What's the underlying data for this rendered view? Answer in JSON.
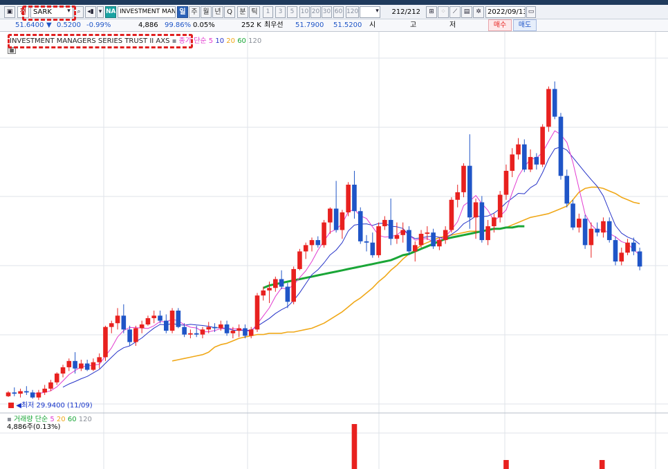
{
  "toolbar": {
    "market_label": "천",
    "symbol": "SARK",
    "na_badge": "NA",
    "name_field": "INVESTMENT MANA",
    "period_tabs": [
      "일",
      "주",
      "월",
      "년",
      "Q",
      "분",
      "틱"
    ],
    "active_tab": "일",
    "intervals": [
      "1",
      "3",
      "5",
      "10",
      "20",
      "30",
      "60",
      "120"
    ],
    "count": "212/212",
    "date": "2022/09/13"
  },
  "quote": {
    "price": "51.6400",
    "change": "0.5200",
    "change_pct": "-0.99%",
    "volume": "4,886",
    "ratio": "99.86%",
    "turnover": "0.05%",
    "amount": "252 K",
    "best_quote_label": "최우선",
    "best_ask": "51.7900",
    "best_bid": "51.5200",
    "open_label": "시",
    "high_label": "고",
    "low_label": "저",
    "buy_label": "매수",
    "sell_label": "매도"
  },
  "chart_legend": {
    "instrument": "INVESTMENT MANAGERS SERIES TRUST II AXS",
    "ma_prefix": "종가 단순",
    "ma_periods": [
      "5",
      "10",
      "20",
      "60",
      "120"
    ]
  },
  "low_marker": "최저 29.9400 (11/09)",
  "volume_legend": {
    "prefix": "거래량 단순",
    "periods": [
      "5",
      "20",
      "60",
      "120"
    ],
    "value": "4,886주(0.13%)"
  },
  "colors": {
    "up": "#e8211f",
    "down": "#1f55c7",
    "ma5": "#e23bd0",
    "ma10": "#2633c8",
    "ma20": "#f0a818",
    "ma60": "#1aa637",
    "grid": "#dfe3ea"
  },
  "chart_data": {
    "type": "candlestick",
    "candles": [
      {
        "o": 30.0,
        "h": 30.4,
        "l": 29.94,
        "c": 30.3
      },
      {
        "o": 30.3,
        "h": 30.7,
        "l": 30.0,
        "c": 30.2
      },
      {
        "o": 30.2,
        "h": 30.6,
        "l": 29.9,
        "c": 30.4
      },
      {
        "o": 30.4,
        "h": 30.8,
        "l": 30.1,
        "c": 30.3
      },
      {
        "o": 30.3,
        "h": 30.5,
        "l": 29.8,
        "c": 29.9
      },
      {
        "o": 29.9,
        "h": 30.5,
        "l": 29.7,
        "c": 30.3
      },
      {
        "o": 30.3,
        "h": 30.9,
        "l": 30.1,
        "c": 30.6
      },
      {
        "o": 30.6,
        "h": 31.3,
        "l": 30.4,
        "c": 31.1
      },
      {
        "o": 31.1,
        "h": 31.9,
        "l": 30.9,
        "c": 31.8
      },
      {
        "o": 31.8,
        "h": 32.5,
        "l": 31.5,
        "c": 32.3
      },
      {
        "o": 32.3,
        "h": 33.0,
        "l": 32.0,
        "c": 32.8
      },
      {
        "o": 32.8,
        "h": 33.5,
        "l": 31.8,
        "c": 32.2
      },
      {
        "o": 32.2,
        "h": 32.9,
        "l": 32.0,
        "c": 32.6
      },
      {
        "o": 32.6,
        "h": 32.9,
        "l": 32.0,
        "c": 32.1
      },
      {
        "o": 32.1,
        "h": 33.0,
        "l": 32.0,
        "c": 32.7
      },
      {
        "o": 32.7,
        "h": 33.4,
        "l": 32.2,
        "c": 33.1
      },
      {
        "o": 33.1,
        "h": 35.6,
        "l": 32.8,
        "c": 35.5
      },
      {
        "o": 35.5,
        "h": 36.0,
        "l": 35.0,
        "c": 35.8
      },
      {
        "o": 35.8,
        "h": 37.0,
        "l": 35.3,
        "c": 36.4
      },
      {
        "o": 36.4,
        "h": 37.3,
        "l": 35.0,
        "c": 35.3
      },
      {
        "o": 35.3,
        "h": 35.6,
        "l": 34.0,
        "c": 34.3
      },
      {
        "o": 34.3,
        "h": 35.6,
        "l": 34.0,
        "c": 35.4
      },
      {
        "o": 35.4,
        "h": 36.0,
        "l": 35.0,
        "c": 35.7
      },
      {
        "o": 35.7,
        "h": 36.4,
        "l": 35.6,
        "c": 36.2
      },
      {
        "o": 36.2,
        "h": 36.8,
        "l": 35.8,
        "c": 36.4
      },
      {
        "o": 36.4,
        "h": 36.8,
        "l": 35.8,
        "c": 36.0
      },
      {
        "o": 36.0,
        "h": 36.5,
        "l": 35.0,
        "c": 35.2
      },
      {
        "o": 35.2,
        "h": 37.0,
        "l": 35.0,
        "c": 36.8
      },
      {
        "o": 36.8,
        "h": 37.0,
        "l": 35.4,
        "c": 35.5
      },
      {
        "o": 35.5,
        "h": 35.8,
        "l": 34.7,
        "c": 34.9
      },
      {
        "o": 34.9,
        "h": 35.3,
        "l": 34.6,
        "c": 35.0
      },
      {
        "o": 35.0,
        "h": 35.6,
        "l": 34.7,
        "c": 34.9
      },
      {
        "o": 34.9,
        "h": 35.5,
        "l": 34.6,
        "c": 35.3
      },
      {
        "o": 35.3,
        "h": 35.9,
        "l": 35.0,
        "c": 35.5
      },
      {
        "o": 35.5,
        "h": 35.8,
        "l": 35.1,
        "c": 35.4
      },
      {
        "o": 35.4,
        "h": 36.0,
        "l": 35.2,
        "c": 35.7
      },
      {
        "o": 35.7,
        "h": 36.0,
        "l": 34.8,
        "c": 35.0
      },
      {
        "o": 35.0,
        "h": 35.5,
        "l": 34.6,
        "c": 35.2
      },
      {
        "o": 35.2,
        "h": 35.7,
        "l": 34.7,
        "c": 35.4
      },
      {
        "o": 35.4,
        "h": 35.7,
        "l": 34.6,
        "c": 34.8
      },
      {
        "o": 34.8,
        "h": 35.5,
        "l": 34.6,
        "c": 35.3
      },
      {
        "o": 35.3,
        "h": 38.2,
        "l": 35.1,
        "c": 38.0
      },
      {
        "o": 38.0,
        "h": 38.7,
        "l": 37.6,
        "c": 38.4
      },
      {
        "o": 38.4,
        "h": 39.1,
        "l": 37.4,
        "c": 38.6
      },
      {
        "o": 38.6,
        "h": 39.5,
        "l": 38.3,
        "c": 39.3
      },
      {
        "o": 39.3,
        "h": 40.0,
        "l": 38.5,
        "c": 38.7
      },
      {
        "o": 38.7,
        "h": 39.0,
        "l": 37.0,
        "c": 37.5
      },
      {
        "o": 37.5,
        "h": 40.3,
        "l": 37.3,
        "c": 40.1
      },
      {
        "o": 40.1,
        "h": 41.7,
        "l": 40.0,
        "c": 41.5
      },
      {
        "o": 41.5,
        "h": 42.2,
        "l": 40.9,
        "c": 42.0
      },
      {
        "o": 42.0,
        "h": 42.6,
        "l": 41.5,
        "c": 42.4
      },
      {
        "o": 42.4,
        "h": 42.7,
        "l": 41.8,
        "c": 42.0
      },
      {
        "o": 42.0,
        "h": 44.0,
        "l": 41.8,
        "c": 43.8
      },
      {
        "o": 43.8,
        "h": 45.0,
        "l": 42.9,
        "c": 44.9
      },
      {
        "o": 44.9,
        "h": 47.1,
        "l": 43.0,
        "c": 43.2
      },
      {
        "o": 43.2,
        "h": 44.8,
        "l": 42.5,
        "c": 44.6
      },
      {
        "o": 44.6,
        "h": 47.0,
        "l": 44.3,
        "c": 46.8
      },
      {
        "o": 46.8,
        "h": 47.9,
        "l": 44.1,
        "c": 44.7
      },
      {
        "o": 44.7,
        "h": 45.0,
        "l": 42.1,
        "c": 42.3
      },
      {
        "o": 42.3,
        "h": 42.8,
        "l": 41.5,
        "c": 42.2
      },
      {
        "o": 42.2,
        "h": 43.0,
        "l": 41.0,
        "c": 41.2
      },
      {
        "o": 41.2,
        "h": 43.8,
        "l": 41.0,
        "c": 43.5
      },
      {
        "o": 43.5,
        "h": 44.3,
        "l": 43.2,
        "c": 44.0
      },
      {
        "o": 44.0,
        "h": 45.7,
        "l": 42.0,
        "c": 42.5
      },
      {
        "o": 42.5,
        "h": 43.8,
        "l": 42.1,
        "c": 42.8
      },
      {
        "o": 42.8,
        "h": 43.8,
        "l": 42.2,
        "c": 43.2
      },
      {
        "o": 43.2,
        "h": 43.5,
        "l": 41.2,
        "c": 41.5
      },
      {
        "o": 41.5,
        "h": 42.3,
        "l": 40.7,
        "c": 42.0
      },
      {
        "o": 42.0,
        "h": 43.2,
        "l": 41.8,
        "c": 42.9
      },
      {
        "o": 42.9,
        "h": 43.5,
        "l": 42.4,
        "c": 43.0
      },
      {
        "o": 43.0,
        "h": 43.3,
        "l": 41.7,
        "c": 41.9
      },
      {
        "o": 41.9,
        "h": 42.6,
        "l": 41.6,
        "c": 42.4
      },
      {
        "o": 42.4,
        "h": 43.5,
        "l": 42.1,
        "c": 43.2
      },
      {
        "o": 43.2,
        "h": 45.8,
        "l": 43.0,
        "c": 45.6
      },
      {
        "o": 45.6,
        "h": 46.8,
        "l": 45.0,
        "c": 46.2
      },
      {
        "o": 46.2,
        "h": 48.5,
        "l": 45.8,
        "c": 48.3
      },
      {
        "o": 48.3,
        "h": 50.8,
        "l": 43.3,
        "c": 44.2
      },
      {
        "o": 44.2,
        "h": 45.7,
        "l": 42.5,
        "c": 45.4
      },
      {
        "o": 45.4,
        "h": 45.9,
        "l": 42.2,
        "c": 42.4
      },
      {
        "o": 42.4,
        "h": 44.0,
        "l": 42.0,
        "c": 43.5
      },
      {
        "o": 43.5,
        "h": 44.5,
        "l": 43.0,
        "c": 44.2
      },
      {
        "o": 44.2,
        "h": 46.3,
        "l": 43.8,
        "c": 46.0
      },
      {
        "o": 46.0,
        "h": 48.4,
        "l": 45.6,
        "c": 47.9
      },
      {
        "o": 47.9,
        "h": 49.7,
        "l": 47.4,
        "c": 49.2
      },
      {
        "o": 49.2,
        "h": 50.5,
        "l": 48.8,
        "c": 50.0
      },
      {
        "o": 50.0,
        "h": 50.4,
        "l": 47.8,
        "c": 48.0
      },
      {
        "o": 48.0,
        "h": 49.6,
        "l": 47.8,
        "c": 49.0
      },
      {
        "o": 49.0,
        "h": 49.3,
        "l": 48.0,
        "c": 48.4
      },
      {
        "o": 48.4,
        "h": 51.6,
        "l": 48.2,
        "c": 51.4
      },
      {
        "o": 51.4,
        "h": 54.6,
        "l": 51.0,
        "c": 54.4
      },
      {
        "o": 54.4,
        "h": 55.0,
        "l": 52.0,
        "c": 52.2
      },
      {
        "o": 52.2,
        "h": 52.5,
        "l": 47.2,
        "c": 47.5
      },
      {
        "o": 47.5,
        "h": 48.0,
        "l": 45.0,
        "c": 45.3
      },
      {
        "o": 45.3,
        "h": 45.6,
        "l": 43.2,
        "c": 43.4
      },
      {
        "o": 43.4,
        "h": 44.5,
        "l": 43.0,
        "c": 44.1
      },
      {
        "o": 44.1,
        "h": 44.4,
        "l": 41.7,
        "c": 42.0
      },
      {
        "o": 42.0,
        "h": 43.8,
        "l": 41.0,
        "c": 43.3
      },
      {
        "o": 43.3,
        "h": 43.8,
        "l": 42.7,
        "c": 43.0
      },
      {
        "o": 43.0,
        "h": 44.2,
        "l": 42.6,
        "c": 43.9
      },
      {
        "o": 43.9,
        "h": 44.2,
        "l": 42.2,
        "c": 42.4
      },
      {
        "o": 42.4,
        "h": 42.7,
        "l": 40.4,
        "c": 40.7
      },
      {
        "o": 40.7,
        "h": 41.8,
        "l": 40.4,
        "c": 41.4
      },
      {
        "o": 41.4,
        "h": 42.5,
        "l": 41.2,
        "c": 42.2
      },
      {
        "o": 42.2,
        "h": 42.6,
        "l": 41.2,
        "c": 41.5
      },
      {
        "o": 41.5,
        "h": 41.8,
        "l": 40.0,
        "c": 40.3
      }
    ],
    "ma20": [
      32.8,
      32.9,
      33.0,
      33.1,
      33.2,
      33.3,
      33.5,
      33.9,
      34.1,
      34.2,
      34.4,
      34.6,
      34.7,
      34.8,
      34.9,
      34.9,
      35.0,
      35.0,
      35.0,
      35.1,
      35.1,
      35.2,
      35.3,
      35.4,
      35.6,
      35.8,
      36.1,
      36.4,
      36.7,
      37.1,
      37.5,
      37.8,
      38.2,
      38.6,
      39.1,
      39.5,
      40.0,
      40.4,
      40.9,
      41.3,
      41.6,
      42.0,
      42.2,
      42.4,
      42.6,
      42.7,
      42.8,
      42.9,
      43.0,
      43.1,
      43.1,
      43.1,
      43.2,
      43.3,
      43.3,
      43.4,
      43.6,
      43.8,
      44.0,
      44.2,
      44.3,
      44.4,
      44.5,
      44.7,
      44.9,
      45.1,
      45.6,
      46.2,
      46.5,
      46.6,
      46.6,
      46.5,
      46.3,
      46.1,
      45.8,
      45.6,
      45.4,
      45.3
    ],
    "ma60": [
      38.6,
      38.8,
      38.9,
      39.0,
      39.1,
      39.2,
      39.3,
      39.4,
      39.5,
      39.6,
      39.7,
      39.8,
      39.9,
      40.0,
      40.1,
      40.2,
      40.3,
      40.4,
      40.5,
      40.6,
      40.7,
      40.8,
      41.0,
      41.2,
      41.3,
      41.5,
      41.7,
      41.9,
      42.1,
      42.3,
      42.5,
      42.6,
      42.7,
      42.8,
      42.9,
      43.0,
      43.1,
      43.2,
      43.3,
      43.3,
      43.4,
      43.4,
      43.5,
      43.5
    ],
    "ylim": [
      29.0,
      58.5
    ],
    "volume": {
      "values": [
        0,
        0,
        0,
        0,
        0,
        0,
        0,
        0,
        0,
        0,
        0,
        0,
        0,
        0,
        0,
        0,
        0,
        0,
        0,
        0,
        0,
        0,
        0,
        0,
        0,
        0,
        0,
        0,
        0,
        0,
        0,
        0,
        0,
        0,
        0,
        0,
        0,
        0,
        0,
        0,
        0,
        0,
        0,
        0,
        0,
        0,
        0,
        0,
        0,
        0,
        0,
        0,
        0,
        0,
        0,
        0,
        0,
        0,
        0,
        0,
        0,
        0,
        0,
        0,
        0,
        0,
        0,
        0,
        0,
        0,
        0,
        0,
        0,
        0,
        0,
        0,
        0,
        0,
        0,
        0,
        0,
        0,
        0,
        0,
        0,
        0,
        0,
        0,
        0,
        0,
        0,
        0,
        0,
        0,
        0,
        0,
        0,
        0,
        0,
        0,
        0,
        0,
        0,
        0,
        0,
        0
      ],
      "spikes": [
        {
          "index": 57,
          "value": 100
        },
        {
          "index": 82,
          "value": 22
        },
        {
          "index": 98,
          "value": 22
        }
      ],
      "ymax": 100
    }
  }
}
